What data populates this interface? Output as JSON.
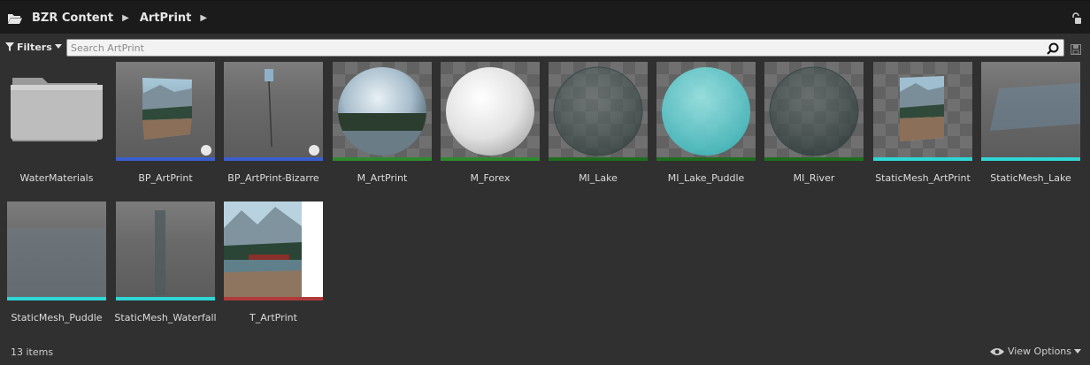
{
  "breadcrumb": {
    "root": "BZR Content",
    "current": "ArtPrint"
  },
  "filters": {
    "label": "Filters"
  },
  "search": {
    "placeholder": "Search ArtPrint",
    "value": ""
  },
  "assets": [
    {
      "name": "WaterMaterials",
      "kind": "folder",
      "bar_color": ""
    },
    {
      "name": "BP_ArtPrint",
      "kind": "blueprint",
      "bar_color": "#3a5fcd"
    },
    {
      "name": "BP_ArtPrint-Bizarre",
      "kind": "blueprint",
      "bar_color": "#3a5fcd"
    },
    {
      "name": "M_ArtPrint",
      "kind": "material",
      "bar_color": "#2e8b2e"
    },
    {
      "name": "M_Forex",
      "kind": "material",
      "bar_color": "#2e8b2e"
    },
    {
      "name": "MI_Lake",
      "kind": "material-instance",
      "bar_color": "#1f6e1f"
    },
    {
      "name": "MI_Lake_Puddle",
      "kind": "material-instance",
      "bar_color": "#1f6e1f"
    },
    {
      "name": "MI_River",
      "kind": "material-instance",
      "bar_color": "#1f6e1f"
    },
    {
      "name": "StaticMesh_ArtPrint",
      "kind": "static-mesh",
      "bar_color": "#2fd6d6"
    },
    {
      "name": "StaticMesh_Lake",
      "kind": "static-mesh",
      "bar_color": "#2fd6d6"
    },
    {
      "name": "StaticMesh_Puddle",
      "kind": "static-mesh",
      "bar_color": "#2fd6d6"
    },
    {
      "name": "StaticMesh_Waterfall",
      "kind": "static-mesh",
      "bar_color": "#2fd6d6"
    },
    {
      "name": "T_ArtPrint",
      "kind": "texture",
      "bar_color": "#b03a3a"
    }
  ],
  "status": {
    "item_count": "13 items"
  },
  "view_options": {
    "label": "View Options"
  }
}
